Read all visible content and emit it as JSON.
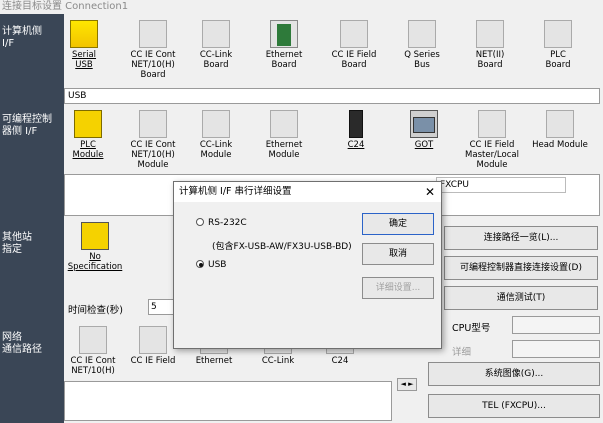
{
  "window": {
    "title": "连接目标设置 Connection1"
  },
  "sidebar": {
    "pc_if": "计算机侧\nI/F",
    "plc_if": "可编程控制\n器侧 I/F",
    "other_station": "其他站\n指定",
    "network_route": "网络\n通信路径"
  },
  "pc_if_row": [
    {
      "label": "Serial\nUSB",
      "icon": "serial-usb-icon"
    },
    {
      "label": "CC IE Cont\nNET/10(H)\nBoard",
      "icon": "board-icon"
    },
    {
      "label": "CC-Link\nBoard",
      "icon": "board-icon"
    },
    {
      "label": "Ethernet\nBoard",
      "icon": "ethernet-board-icon"
    },
    {
      "label": "CC IE Field\nBoard",
      "icon": "board-icon"
    },
    {
      "label": "Q Series\nBus",
      "icon": "board-icon"
    },
    {
      "label": "NET(II)\nBoard",
      "icon": "board-icon"
    },
    {
      "label": "PLC\nBoard",
      "icon": "board-icon"
    }
  ],
  "pc_if_strip": "USB",
  "plc_if_row": [
    {
      "label": "PLC\nModule",
      "icon": "plc-module-icon"
    },
    {
      "label": "CC IE Cont\nNET/10(H)\nModule",
      "icon": "module-icon"
    },
    {
      "label": "CC-Link\nModule",
      "icon": "module-icon"
    },
    {
      "label": "Ethernet\nModule",
      "icon": "module-icon"
    },
    {
      "label": "C24",
      "icon": "c24-icon"
    },
    {
      "label": "GOT",
      "icon": "got-icon"
    },
    {
      "label": "CC IE Field\nMaster/Local\nModule",
      "icon": "module-icon"
    },
    {
      "label": "Head Module",
      "icon": "module-icon"
    }
  ],
  "plc_strip": "FXCPU",
  "other_station": {
    "label": "No Specification"
  },
  "timeout": {
    "label": "时间检查(秒)",
    "value": "5"
  },
  "network_row": [
    {
      "label": "CC IE Cont\nNET/10(H)"
    },
    {
      "label": "CC IE Field"
    },
    {
      "label": "Ethernet"
    },
    {
      "label": "CC-Link"
    },
    {
      "label": "C24"
    }
  ],
  "right_panel": {
    "route_list": "连接路径一览(L)...",
    "direct_conn": "可编程控制器直接连接设置(D)",
    "comm_test": "通信测试(T)",
    "cpu_type": "CPU型号",
    "detail": "详细",
    "system_image": "系统图像(G)...",
    "tel": "TEL (FXCPU)..."
  },
  "spin": "◄ ►",
  "dialog": {
    "title": "计算机侧 I/F 串行详细设置",
    "close": "✕",
    "rs232c": "RS-232C",
    "include_note": "(包含FX-USB-AW/FX3U-USB-BD)",
    "usb": "USB",
    "ok": "确定",
    "cancel": "取消",
    "detail": "详细设置..."
  }
}
